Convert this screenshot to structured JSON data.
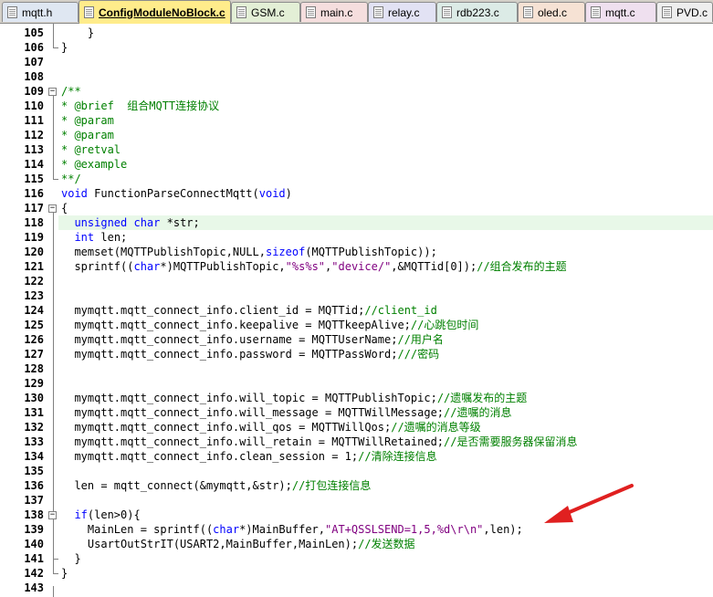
{
  "tabs": [
    {
      "label": "mqtt.h",
      "active": false,
      "color": "#dfe7f2"
    },
    {
      "label": "ConfigModuleNoBlock.c",
      "active": true,
      "color": "#ffec8b"
    },
    {
      "label": "GSM.c",
      "active": false,
      "color": "#e3efd6"
    },
    {
      "label": "main.c",
      "active": false,
      "color": "#f5dede"
    },
    {
      "label": "relay.c",
      "active": false,
      "color": "#e2e2f4"
    },
    {
      "label": "rdb223.c",
      "active": false,
      "color": "#dcebe6"
    },
    {
      "label": "oled.c",
      "active": false,
      "color": "#f6e2d4"
    },
    {
      "label": "mqtt.c",
      "active": false,
      "color": "#efe0ef"
    },
    {
      "label": "PVD.c",
      "active": false,
      "color": "#eeeeee"
    }
  ],
  "lines": [
    {
      "n": "105",
      "code": [
        {
          "t": "    }",
          "c": ""
        }
      ]
    },
    {
      "n": "106",
      "code": [
        {
          "t": "}",
          "c": ""
        }
      ]
    },
    {
      "n": "107",
      "code": []
    },
    {
      "n": "108",
      "code": []
    },
    {
      "n": "109",
      "code": [
        {
          "t": "/**",
          "c": "cm"
        }
      ]
    },
    {
      "n": "110",
      "code": [
        {
          "t": "* @brief  ",
          "c": "cm"
        },
        {
          "t": "组合MQTT连接协议",
          "c": "cm"
        }
      ]
    },
    {
      "n": "111",
      "code": [
        {
          "t": "* @param",
          "c": "cm"
        }
      ]
    },
    {
      "n": "112",
      "code": [
        {
          "t": "* @param",
          "c": "cm"
        }
      ]
    },
    {
      "n": "113",
      "code": [
        {
          "t": "* @retval",
          "c": "cm"
        }
      ]
    },
    {
      "n": "114",
      "code": [
        {
          "t": "* @example",
          "c": "cm"
        }
      ]
    },
    {
      "n": "115",
      "code": [
        {
          "t": "**/",
          "c": "cm"
        }
      ]
    },
    {
      "n": "116",
      "code": [
        {
          "t": "void",
          "c": "kw"
        },
        {
          "t": " FunctionParseConnectMqtt(",
          "c": ""
        },
        {
          "t": "void",
          "c": "kw"
        },
        {
          "t": ")",
          "c": ""
        }
      ]
    },
    {
      "n": "117",
      "code": [
        {
          "t": "{",
          "c": ""
        }
      ]
    },
    {
      "n": "118",
      "code": [
        {
          "t": "  ",
          "c": ""
        },
        {
          "t": "unsigned",
          "c": "kw"
        },
        {
          "t": " ",
          "c": ""
        },
        {
          "t": "char",
          "c": "kw"
        },
        {
          "t": " *str;",
          "c": ""
        }
      ]
    },
    {
      "n": "119",
      "code": [
        {
          "t": "  ",
          "c": ""
        },
        {
          "t": "int",
          "c": "kw"
        },
        {
          "t": " len;",
          "c": ""
        }
      ]
    },
    {
      "n": "120",
      "code": [
        {
          "t": "  memset(MQTTPublishTopic,NULL,",
          "c": ""
        },
        {
          "t": "sizeof",
          "c": "kw"
        },
        {
          "t": "(MQTTPublishTopic));",
          "c": ""
        }
      ]
    },
    {
      "n": "121",
      "code": [
        {
          "t": "  sprintf((",
          "c": ""
        },
        {
          "t": "char",
          "c": "kw"
        },
        {
          "t": "*)MQTTPublishTopic,",
          "c": ""
        },
        {
          "t": "\"%s%s\"",
          "c": "st"
        },
        {
          "t": ",",
          "c": ""
        },
        {
          "t": "\"device/\"",
          "c": "st"
        },
        {
          "t": ",&MQTTid[0]);",
          "c": ""
        },
        {
          "t": "//组合发布的主题",
          "c": "cm"
        }
      ]
    },
    {
      "n": "122",
      "code": []
    },
    {
      "n": "123",
      "code": []
    },
    {
      "n": "124",
      "code": [
        {
          "t": "  mymqtt.mqtt_connect_info.client_id = MQTTid;",
          "c": ""
        },
        {
          "t": "//client_id",
          "c": "cm"
        }
      ]
    },
    {
      "n": "125",
      "code": [
        {
          "t": "  mymqtt.mqtt_connect_info.keepalive = MQTTkeepAlive;",
          "c": ""
        },
        {
          "t": "//心跳包时间",
          "c": "cm"
        }
      ]
    },
    {
      "n": "126",
      "code": [
        {
          "t": "  mymqtt.mqtt_connect_info.username = MQTTUserName;",
          "c": ""
        },
        {
          "t": "//用户名",
          "c": "cm"
        }
      ]
    },
    {
      "n": "127",
      "code": [
        {
          "t": "  mymqtt.mqtt_connect_info.password = MQTTPassWord;",
          "c": ""
        },
        {
          "t": "///密码",
          "c": "cm"
        }
      ]
    },
    {
      "n": "128",
      "code": []
    },
    {
      "n": "129",
      "code": []
    },
    {
      "n": "130",
      "code": [
        {
          "t": "  mymqtt.mqtt_connect_info.will_topic = MQTTPublishTopic;",
          "c": ""
        },
        {
          "t": "//遗嘱发布的主题",
          "c": "cm"
        }
      ]
    },
    {
      "n": "131",
      "code": [
        {
          "t": "  mymqtt.mqtt_connect_info.will_message = MQTTWillMessage;",
          "c": ""
        },
        {
          "t": "//遗嘱的消息",
          "c": "cm"
        }
      ]
    },
    {
      "n": "132",
      "code": [
        {
          "t": "  mymqtt.mqtt_connect_info.will_qos = MQTTWillQos;",
          "c": ""
        },
        {
          "t": "//遗嘱的消息等级",
          "c": "cm"
        }
      ]
    },
    {
      "n": "133",
      "code": [
        {
          "t": "  mymqtt.mqtt_connect_info.will_retain = MQTTWillRetained;",
          "c": ""
        },
        {
          "t": "//是否需要服务器保留消息",
          "c": "cm"
        }
      ]
    },
    {
      "n": "134",
      "code": [
        {
          "t": "  mymqtt.mqtt_connect_info.clean_session = ",
          "c": ""
        },
        {
          "t": "1",
          "c": ""
        },
        {
          "t": ";",
          "c": ""
        },
        {
          "t": "//清除连接信息",
          "c": "cm"
        }
      ]
    },
    {
      "n": "135",
      "code": []
    },
    {
      "n": "136",
      "code": [
        {
          "t": "  len = mqtt_connect(&mymqtt,&str);",
          "c": ""
        },
        {
          "t": "//打包连接信息",
          "c": "cm"
        }
      ]
    },
    {
      "n": "137",
      "code": []
    },
    {
      "n": "138",
      "code": [
        {
          "t": "  ",
          "c": ""
        },
        {
          "t": "if",
          "c": "kw"
        },
        {
          "t": "(len>0){",
          "c": ""
        }
      ]
    },
    {
      "n": "139",
      "code": [
        {
          "t": "    MainLen = sprintf((",
          "c": ""
        },
        {
          "t": "char",
          "c": "kw"
        },
        {
          "t": "*)MainBuffer,",
          "c": ""
        },
        {
          "t": "\"AT+QSSLSEND=1,5,%d\\r\\n\"",
          "c": "st"
        },
        {
          "t": ",len);",
          "c": ""
        }
      ]
    },
    {
      "n": "140",
      "code": [
        {
          "t": "    UsartOutStrIT(USART2,MainBuffer,MainLen);",
          "c": ""
        },
        {
          "t": "//发送数据",
          "c": "cm"
        }
      ]
    },
    {
      "n": "141",
      "code": [
        {
          "t": "  }",
          "c": ""
        }
      ]
    },
    {
      "n": "142",
      "code": [
        {
          "t": "}",
          "c": ""
        }
      ]
    },
    {
      "n": "143",
      "code": []
    }
  ],
  "highlighted_line": "118",
  "colors": {
    "keyword": "#0000ff",
    "comment": "#008000",
    "string": "#800080",
    "highlight": "#e8f8e8",
    "active_tab": "#ffec8b",
    "arrow": "#e02020"
  }
}
